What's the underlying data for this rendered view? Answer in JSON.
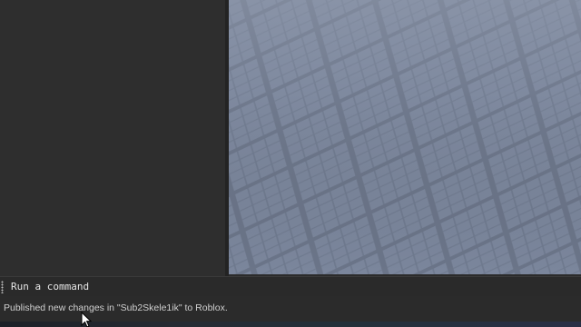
{
  "command_bar": {
    "placeholder": "Run a command"
  },
  "status_bar": {
    "message": "Published new changes in \"Sub2Skele1ik\" to Roblox."
  },
  "icons": {
    "grip": "grip-dots-icon",
    "cursor": "mouse-cursor-icon"
  },
  "colors": {
    "panel_bg": "#2e2e2e",
    "viewport_tile": "#6f7a90",
    "status_text": "#cfcfcf"
  }
}
